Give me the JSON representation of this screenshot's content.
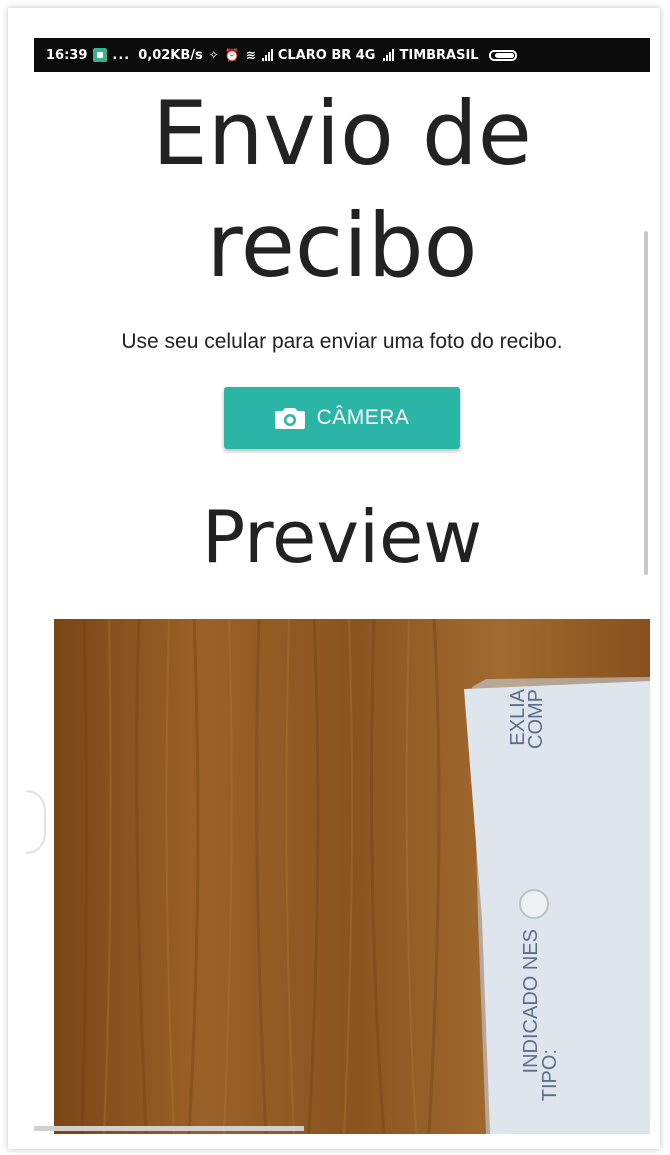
{
  "status_bar": {
    "time": "16:39",
    "dots": "...",
    "speed": "0,02KB/s",
    "carrier1": "CLARO BR 4G",
    "carrier2": "TIMBRASIL"
  },
  "page": {
    "title": "Envio de recibo",
    "subtitle": "Use seu celular para enviar uma foto do recibo.",
    "camera_button": "CÂMERA",
    "preview_title": "Preview"
  },
  "preview": {
    "receipt_lines": [
      "EXLIA",
      "COMP",
      "INDICADO NES",
      "TIPO:"
    ]
  },
  "colors": {
    "button": "#2bb5a6",
    "wood": "#8e5a24"
  },
  "icons": {
    "camera": "camera-icon",
    "battery": "battery-icon",
    "wifi": "wifi-icon",
    "alarm": "alarm-icon"
  }
}
